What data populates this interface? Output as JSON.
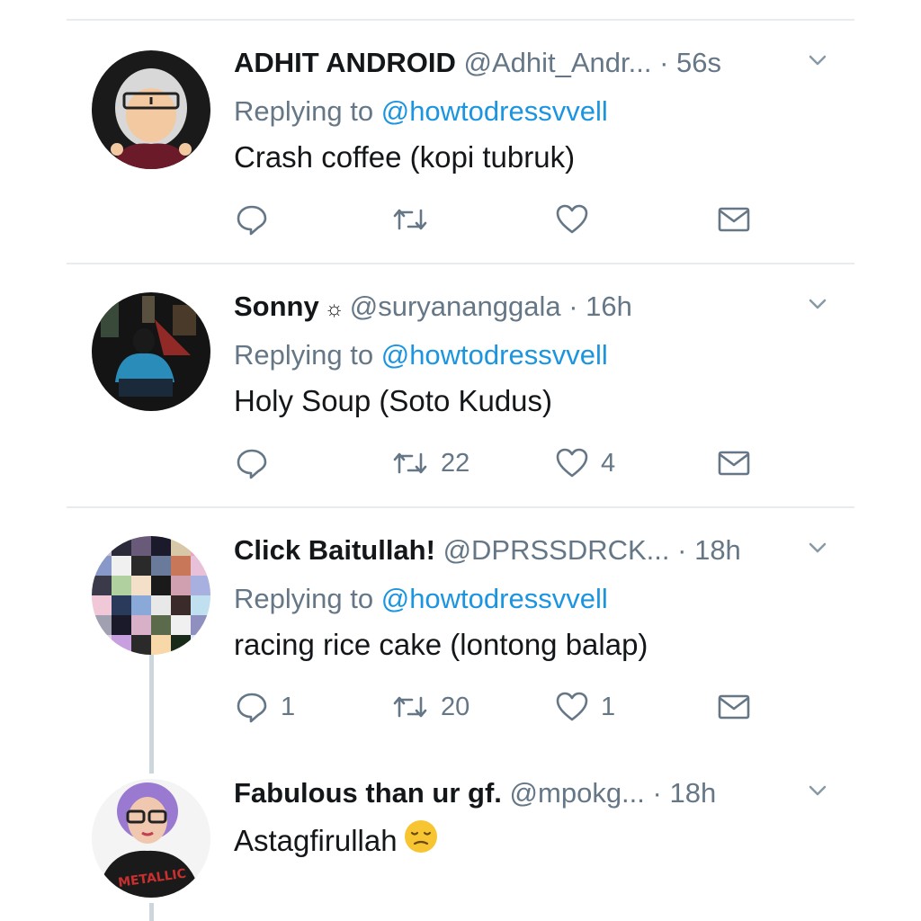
{
  "tweets": [
    {
      "name": "ADHIT ANDROID",
      "handle": "@Adhit_Andr...",
      "time": "· 56s",
      "replying_label": "Replying to",
      "replying_to": "@howtodressvvell",
      "text": "Crash coffee (kopi tubruk)",
      "reply_count": "",
      "retweet_count": "",
      "like_count": ""
    },
    {
      "name": "Sonny",
      "name_badge": "☼",
      "handle": "@suryananggala",
      "time": "· 16h",
      "replying_label": "Replying to",
      "replying_to": "@howtodressvvell",
      "text": "Holy Soup (Soto Kudus)",
      "reply_count": "",
      "retweet_count": "22",
      "like_count": "4"
    },
    {
      "name": "Click Baitullah!",
      "handle": "@DPRSSDRCK...",
      "time": "· 18h",
      "replying_label": "Replying to",
      "replying_to": "@howtodressvvell",
      "text": "racing rice cake (lontong balap)",
      "reply_count": "1",
      "retweet_count": "20",
      "like_count": "1"
    },
    {
      "name": "Fabulous than ur gf.",
      "handle": "@mpokg...",
      "time": "· 18h",
      "text": "Astagfirullah",
      "emoji": "unamused-face-emoji"
    }
  ],
  "colors": {
    "name": "#14171a",
    "secondary": "#657786",
    "mention": "#1b95e0",
    "divider": "#e6ecf0",
    "thread_line": "#ccd6dd"
  },
  "icons": [
    "chevron-down-icon",
    "reply-icon",
    "retweet-icon",
    "like-icon",
    "direct-message-icon"
  ]
}
